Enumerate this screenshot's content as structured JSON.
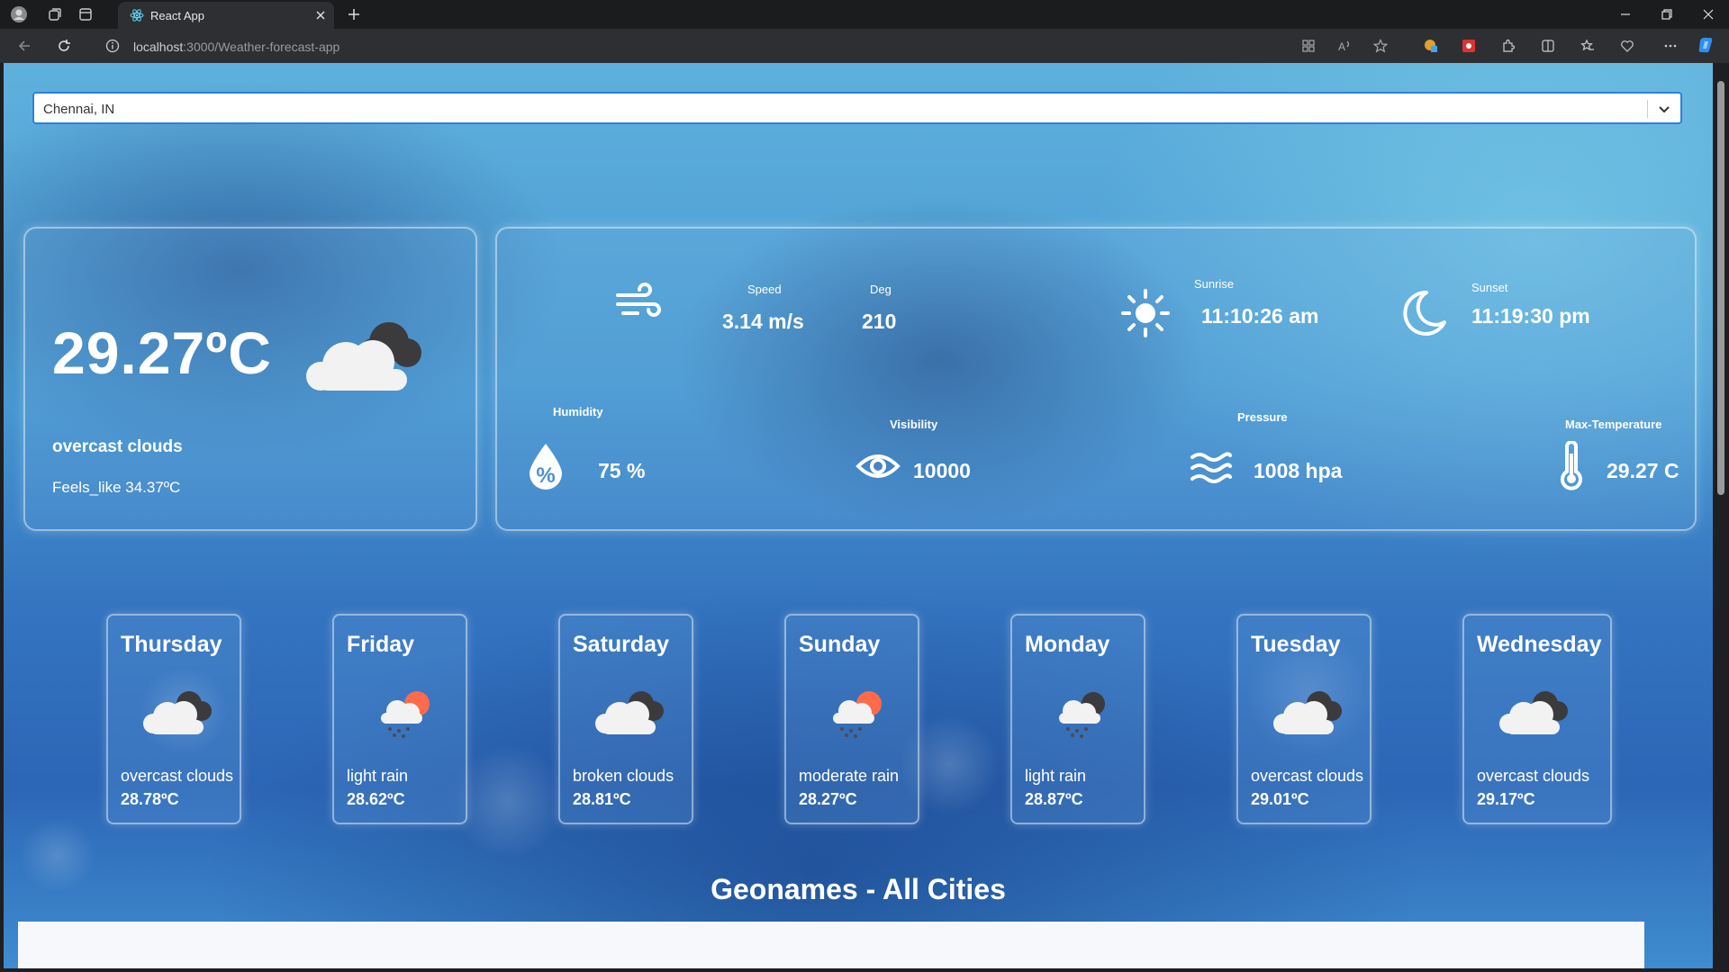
{
  "browser": {
    "tab_title": "React App",
    "url_host": "localhost",
    "url_path": ":3000/Weather-forecast-app"
  },
  "search": {
    "value": "Chennai, IN"
  },
  "current": {
    "temp": "29.27ºC",
    "icon": "overcast-clouds-icon",
    "description": "overcast clouds",
    "feels_like": "Feels_like 34.37ºC"
  },
  "details": {
    "speed_label": "Speed",
    "speed_value": "3.14 m/s",
    "deg_label": "Deg",
    "deg_value": "210",
    "sunrise_label": "Sunrise",
    "sunrise_value": "11:10:26 am",
    "sunset_label": "Sunset",
    "sunset_value": "11:19:30 pm",
    "humidity_label": "Humidity",
    "humidity_value": "75 %",
    "visibility_label": "Visibility",
    "visibility_value": "10000",
    "pressure_label": "Pressure",
    "pressure_value": "1008 hpa",
    "maxtemp_label": "Max-Temperature",
    "maxtemp_value": "29.27 C"
  },
  "forecast": [
    {
      "day": "Thursday",
      "desc": "overcast clouds",
      "temp": "28.78ºC",
      "icon": "cloud-icon"
    },
    {
      "day": "Friday",
      "desc": "light rain",
      "temp": "28.62ºC",
      "icon": "sun-rain-cloud-icon"
    },
    {
      "day": "Saturday",
      "desc": "broken clouds",
      "temp": "28.81ºC",
      "icon": "cloud-icon"
    },
    {
      "day": "Sunday",
      "desc": "moderate rain",
      "temp": "28.27ºC",
      "icon": "sun-rain-cloud-icon"
    },
    {
      "day": "Monday",
      "desc": "light rain",
      "temp": "28.87ºC",
      "icon": "rain-cloud-icon"
    },
    {
      "day": "Tuesday",
      "desc": "overcast clouds",
      "temp": "29.01ºC",
      "icon": "cloud-icon"
    },
    {
      "day": "Wednesday",
      "desc": "overcast clouds",
      "temp": "29.17ºC",
      "icon": "cloud-icon"
    }
  ],
  "cities_title": "Geonames - All Cities",
  "colors": {
    "accent_border": "#2f7fe0",
    "sun": "#ff6b4a",
    "card_text": "#ffffff"
  }
}
